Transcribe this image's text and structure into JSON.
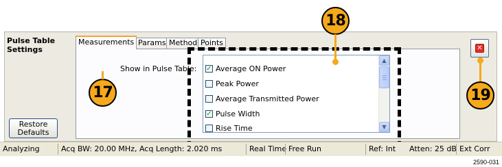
{
  "panel": {
    "title": "Pulse Table\nSettings",
    "restore_label": "Restore\nDefaults"
  },
  "tabs": [
    {
      "label": "Measurements",
      "active": true
    },
    {
      "label": "Params",
      "active": false
    },
    {
      "label": "Method",
      "active": false
    },
    {
      "label": "Points",
      "active": false
    }
  ],
  "measurements": {
    "show_label": "Show in Pulse Table:",
    "items": [
      {
        "label": "Average ON Power",
        "checked": true
      },
      {
        "label": "Peak Power",
        "checked": false
      },
      {
        "label": "Average Transmitted Power",
        "checked": false
      },
      {
        "label": "Pulse Width",
        "checked": true
      },
      {
        "label": "Rise Time",
        "checked": false
      }
    ]
  },
  "callouts": {
    "c17": "17",
    "c18": "18",
    "c19": "19"
  },
  "status_bar": {
    "analyzing": "Analyzing",
    "acq": "Acq BW: 20.00 MHz, Acq Length: 2.020 ms",
    "real_time": "Real Time",
    "free_run": "Free Run",
    "ref": "Ref: Int",
    "atten": "Atten: 25 dB",
    "ext_corr": "Ext Corr"
  },
  "figure_id": "2590-031",
  "colors": {
    "callout": "#f5a91b",
    "active_tab_accent": "#f2a530",
    "close_red": "#e52b2b"
  }
}
